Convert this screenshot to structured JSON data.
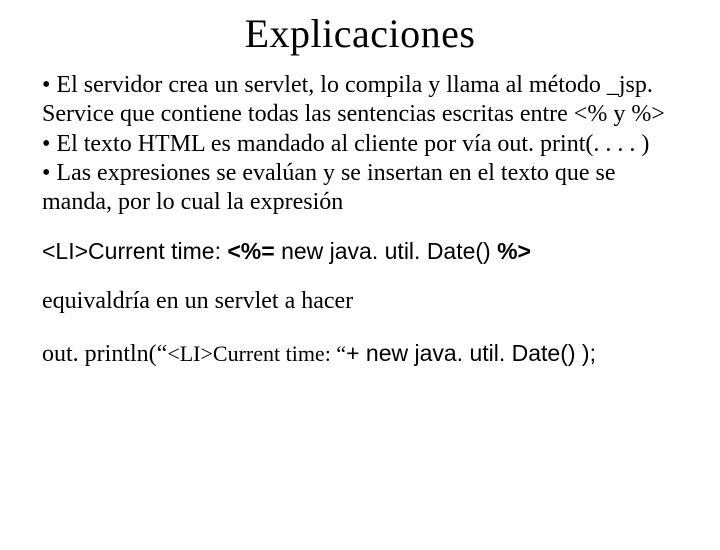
{
  "title": "Explicaciones",
  "bullets": {
    "b1": "• El servidor crea un servlet, lo compila y llama al método _jsp. Service  que contiene todas las sentencias escritas entre <% y %>",
    "b2": "• El texto HTML es mandado al cliente por vía out. print(. . . . )",
    "b3": "• Las expresiones se evalúan y se insertan en el texto que se manda, por lo cual la expresión"
  },
  "code_li_prefix": "<LI>Current time: ",
  "code_bold": "<%=",
  "code_mid": " new java. util. Date() ",
  "code_bold_end": "%>",
  "equiv_text": "equivaldría en un servlet a hacer",
  "out_prefix": "out. println(“",
  "out_li": "<LI>Current time: “",
  "out_plus": "+ ",
  "out_tail": "new java. util. Date() );"
}
